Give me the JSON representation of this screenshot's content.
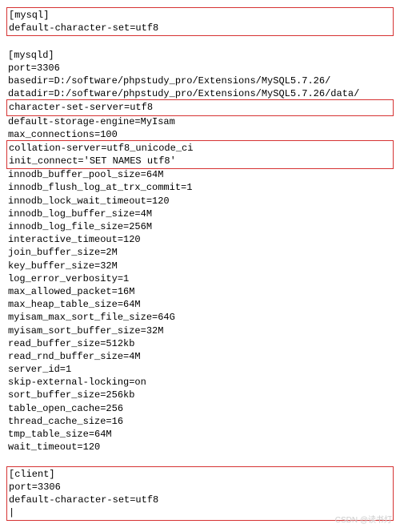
{
  "blocks": {
    "mysql": {
      "l0": "[mysql]",
      "l1": "default-character-set=utf8"
    },
    "mysqld_head": {
      "l0": "[mysqld]",
      "l1": "port=3306",
      "l2": "basedir=D:/software/phpstudy_pro/Extensions/MySQL5.7.26/",
      "l3": "datadir=D:/software/phpstudy_pro/Extensions/MySQL5.7.26/data/"
    },
    "mysqld_box1": {
      "l0": "character-set-server=utf8"
    },
    "mysqld_mid1": {
      "l0": "default-storage-engine=MyIsam",
      "l1": "max_connections=100"
    },
    "mysqld_box2": {
      "l0": "collation-server=utf8_unicode_ci",
      "l1": "init_connect='SET NAMES utf8'"
    },
    "mysqld_rest": {
      "l0": "innodb_buffer_pool_size=64M",
      "l1": "innodb_flush_log_at_trx_commit=1",
      "l2": "innodb_lock_wait_timeout=120",
      "l3": "innodb_log_buffer_size=4M",
      "l4": "innodb_log_file_size=256M",
      "l5": "interactive_timeout=120",
      "l6": "join_buffer_size=2M",
      "l7": "key_buffer_size=32M",
      "l8": "log_error_verbosity=1",
      "l9": "max_allowed_packet=16M",
      "l10": "max_heap_table_size=64M",
      "l11": "myisam_max_sort_file_size=64G",
      "l12": "myisam_sort_buffer_size=32M",
      "l13": "read_buffer_size=512kb",
      "l14": "read_rnd_buffer_size=4M",
      "l15": "server_id=1",
      "l16": "skip-external-locking=on",
      "l17": "sort_buffer_size=256kb",
      "l18": "table_open_cache=256",
      "l19": "thread_cache_size=16",
      "l20": "tmp_table_size=64M",
      "l21": "wait_timeout=120"
    },
    "client": {
      "l0": "[client]",
      "l1": "port=3306",
      "l2": "default-character-set=utf8",
      "l3": "|"
    }
  },
  "watermark": "CSDN @读书灯"
}
